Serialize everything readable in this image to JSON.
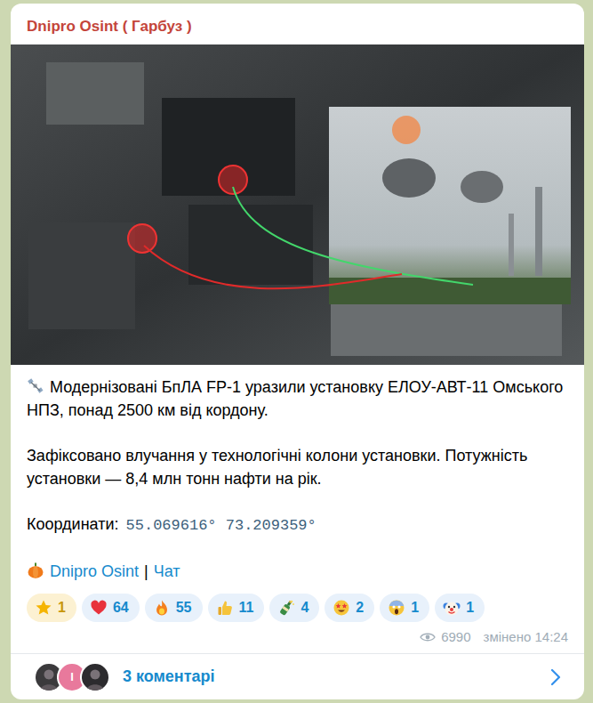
{
  "channel": {
    "name": "Dnipro Osint ( Гарбуз )"
  },
  "post": {
    "paragraphs": [
      "Модернізовані БпЛА FP-1 уразили установку ЕЛОУ-АВТ-11 Омського НПЗ, понад 2500 км від кордону.",
      "Зафіксовано влучання у технологічні колони установки. Потужність установки — 8,4 млн тонн нафти на рік."
    ],
    "coordinates": {
      "label": "Координати:",
      "value": "55.069616° 73.209359°"
    },
    "links": [
      {
        "label": "Dnipro Osint"
      },
      {
        "label": "Чат"
      }
    ],
    "separator": "|"
  },
  "reactions": [
    {
      "kind": "star",
      "count": "1",
      "paid": true
    },
    {
      "kind": "heart",
      "count": "64",
      "paid": false
    },
    {
      "kind": "fire",
      "count": "55",
      "paid": false
    },
    {
      "kind": "thumbs-up",
      "count": "11",
      "paid": false
    },
    {
      "kind": "champagne",
      "count": "4",
      "paid": false
    },
    {
      "kind": "star-struck",
      "count": "2",
      "paid": false
    },
    {
      "kind": "scream",
      "count": "1",
      "paid": false
    },
    {
      "kind": "clown",
      "count": "1",
      "paid": false
    }
  ],
  "meta": {
    "views": "6990",
    "edited": "змінено 14:24"
  },
  "comments": {
    "avatars": [
      {
        "kind": "photo",
        "letter": "",
        "color": "#3b3a3c"
      },
      {
        "kind": "letter",
        "letter": "I",
        "color": "#e8799c"
      },
      {
        "kind": "photo",
        "letter": "",
        "color": "#2c2b2e"
      }
    ],
    "label": "3 коментарі"
  }
}
